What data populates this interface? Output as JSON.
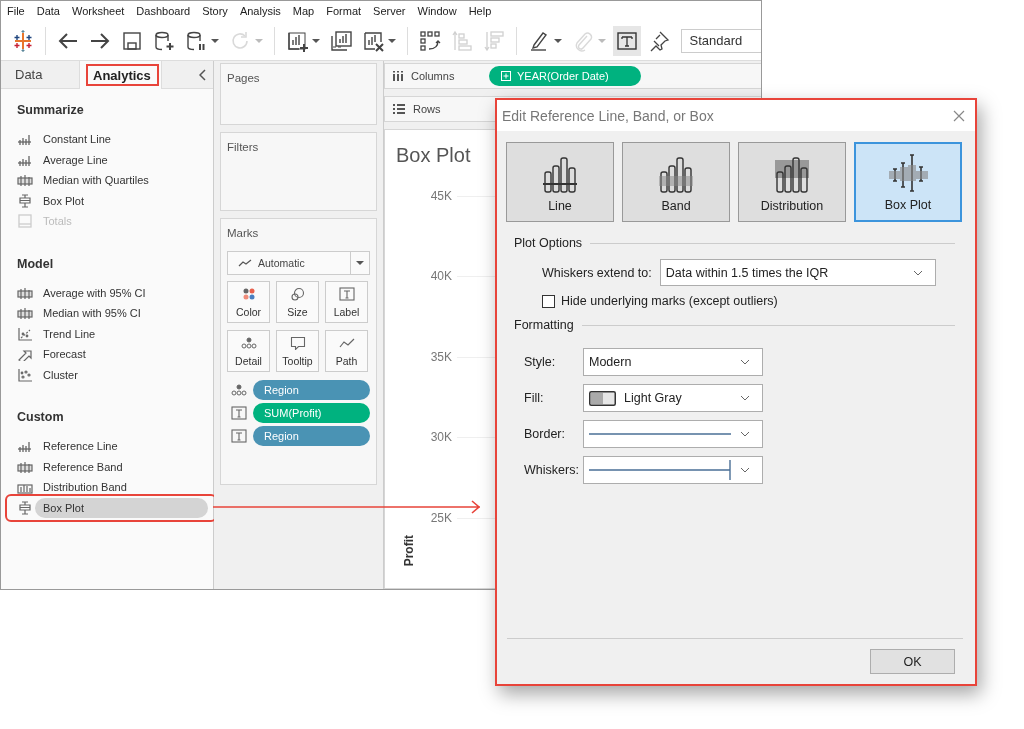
{
  "menu_bar": {
    "items": [
      "File",
      "Data",
      "Worksheet",
      "Dashboard",
      "Story",
      "Analysis",
      "Map",
      "Format",
      "Server",
      "Window",
      "Help"
    ]
  },
  "toolbar": {
    "groups": [
      [
        {
          "kind": "logo",
          "disabled": false,
          "pressed": false,
          "menu": false
        }
      ],
      [
        {
          "kind": "back",
          "disabled": false,
          "pressed": false,
          "menu": false
        },
        {
          "kind": "forward",
          "disabled": false,
          "pressed": false,
          "menu": false
        },
        {
          "kind": "save",
          "disabled": false,
          "pressed": false,
          "menu": false
        },
        {
          "kind": "new_data_source",
          "disabled": false,
          "pressed": false,
          "menu": false
        },
        {
          "kind": "pause_updates",
          "disabled": false,
          "pressed": false,
          "menu": true
        },
        {
          "kind": "refresh",
          "disabled": true,
          "pressed": false,
          "menu": true
        }
      ],
      [
        {
          "kind": "new_sheet",
          "disabled": false,
          "pressed": false,
          "menu": true
        },
        {
          "kind": "duplicate_sheet",
          "disabled": false,
          "pressed": false,
          "menu": false
        },
        {
          "kind": "clear_sheet",
          "disabled": false,
          "pressed": false,
          "menu": true
        }
      ],
      [
        {
          "kind": "swap",
          "disabled": false,
          "pressed": false,
          "menu": false
        },
        {
          "kind": "sort_ascending",
          "disabled": true,
          "pressed": false,
          "menu": false
        },
        {
          "kind": "sort_descending",
          "disabled": true,
          "pressed": false,
          "menu": false
        }
      ],
      [
        {
          "kind": "highlight",
          "disabled": false,
          "pressed": false,
          "menu": true
        },
        {
          "kind": "attach",
          "disabled": true,
          "pressed": false,
          "menu": true
        },
        {
          "kind": "show_labels",
          "disabled": false,
          "pressed": true,
          "menu": false
        },
        {
          "kind": "pin",
          "disabled": false,
          "pressed": false,
          "menu": false
        }
      ]
    ],
    "fit": "Standard"
  },
  "side_pane": {
    "tabs": [
      {
        "label": "Data",
        "selected": false,
        "callout": false
      },
      {
        "label": "Analytics",
        "selected": true,
        "callout": true
      }
    ],
    "sections": [
      {
        "title": "Summarize",
        "items": [
          {
            "label": "Constant Line",
            "kind": "line",
            "disabled": false,
            "selected": false,
            "callout": false
          },
          {
            "label": "Average Line",
            "kind": "line",
            "disabled": false,
            "selected": false,
            "callout": false
          },
          {
            "label": "Median with Quartiles",
            "kind": "band",
            "disabled": false,
            "selected": false,
            "callout": false
          },
          {
            "label": "Box Plot",
            "kind": "boxplot",
            "disabled": false,
            "selected": false,
            "callout": false
          },
          {
            "label": "Totals",
            "kind": "totals",
            "disabled": true,
            "selected": false,
            "callout": false
          }
        ]
      },
      {
        "title": "Model",
        "items": [
          {
            "label": "Average with 95% CI",
            "kind": "band",
            "disabled": false,
            "selected": false,
            "callout": false
          },
          {
            "label": "Median with 95% CI",
            "kind": "band",
            "disabled": false,
            "selected": false,
            "callout": false
          },
          {
            "label": "Trend Line",
            "kind": "trend",
            "disabled": false,
            "selected": false,
            "callout": false
          },
          {
            "label": "Forecast",
            "kind": "forecast",
            "disabled": false,
            "selected": false,
            "callout": false
          },
          {
            "label": "Cluster",
            "kind": "cluster",
            "disabled": false,
            "selected": false,
            "callout": false
          }
        ]
      },
      {
        "title": "Custom",
        "items": [
          {
            "label": "Reference Line",
            "kind": "line",
            "disabled": false,
            "selected": false,
            "callout": false
          },
          {
            "label": "Reference Band",
            "kind": "band",
            "disabled": false,
            "selected": false,
            "callout": false
          },
          {
            "label": "Distribution Band",
            "kind": "distribution",
            "disabled": false,
            "selected": false,
            "callout": false
          },
          {
            "label": "Box Plot",
            "kind": "boxplot",
            "disabled": false,
            "selected": true,
            "callout": true
          }
        ]
      }
    ]
  },
  "cards": {
    "pages": {
      "title": "Pages"
    },
    "filters": {
      "title": "Filters"
    },
    "marks": {
      "title": "Marks",
      "mark_type": "Automatic",
      "properties": [
        {
          "label": "Color",
          "kind": "color"
        },
        {
          "label": "Size",
          "kind": "size"
        },
        {
          "label": "Label",
          "kind": "label"
        },
        {
          "label": "Detail",
          "kind": "detail"
        },
        {
          "label": "Tooltip",
          "kind": "tooltip"
        },
        {
          "label": "Path",
          "kind": "path"
        }
      ],
      "fields": [
        {
          "kind": "detail",
          "name": "Region",
          "color": "#4a93b4"
        },
        {
          "kind": "label",
          "name": "SUM(Profit)",
          "color": "#00b27f"
        },
        {
          "kind": "label",
          "name": "Region",
          "color": "#4a93b4"
        }
      ]
    }
  },
  "shelves": [
    {
      "label": "Columns",
      "kind": "columns",
      "pills": [
        {
          "name": "YEAR(Order Date)",
          "color": "#00b27f"
        }
      ]
    },
    {
      "label": "Rows",
      "kind": "rows"
    }
  ],
  "view": {
    "title": "Box Plot",
    "y_axis": {
      "title": "Profit",
      "ticks": [
        "45K",
        "40K",
        "35K",
        "30K",
        "25K"
      ]
    }
  },
  "dialog": {
    "title": "Edit Reference Line, Band, or Box",
    "callout": true,
    "types": [
      {
        "label": "Line",
        "kind": "line",
        "selected": false
      },
      {
        "label": "Band",
        "kind": "band",
        "selected": false
      },
      {
        "label": "Distribution",
        "kind": "distribution",
        "selected": false
      },
      {
        "label": "Box Plot",
        "kind": "boxplot",
        "selected": true
      }
    ],
    "plot_options": {
      "title": "Plot Options",
      "whiskers_label": "Whiskers extend to:",
      "whiskers_value": "Data within 1.5 times the IQR",
      "hide_marks": {
        "label": "Hide underlying marks (except outliers)",
        "checked": false
      }
    },
    "formatting": {
      "title": "Formatting",
      "rows": [
        {
          "label": "Style:",
          "kind": "text",
          "value": "Modern"
        },
        {
          "label": "Fill:",
          "kind": "swatch",
          "value": "Light Gray"
        },
        {
          "label": "Border:",
          "kind": "line"
        },
        {
          "label": "Whiskers:",
          "kind": "whisker"
        }
      ]
    },
    "ok_button": "OK"
  }
}
